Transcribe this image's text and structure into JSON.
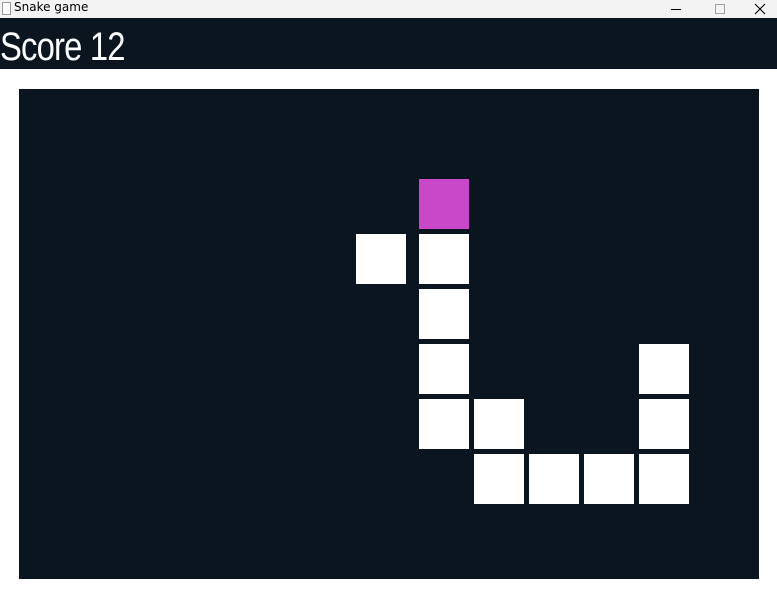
{
  "window": {
    "title": "Snake game"
  },
  "hud": {
    "score_text": "Score 12"
  },
  "colors": {
    "background": "#0a1520",
    "snake": "#ffffff",
    "food": "#c948c9"
  },
  "grid": {
    "cols": 13,
    "rows": 9
  },
  "food": {
    "col": 7,
    "row": 1
  },
  "snake": [
    {
      "col": 7,
      "row": 2
    },
    {
      "col": 7,
      "row": 3
    },
    {
      "col": 7,
      "row": 4
    },
    {
      "col": 7,
      "row": 5
    },
    {
      "col": 8,
      "row": 5
    },
    {
      "col": 8,
      "row": 6
    },
    {
      "col": 9,
      "row": 6
    },
    {
      "col": 10,
      "row": 6
    },
    {
      "col": 11,
      "row": 6
    },
    {
      "col": 11,
      "row": 5
    },
    {
      "col": 11,
      "row": 4
    }
  ],
  "stray_block": {
    "col": 6,
    "row": 2
  }
}
